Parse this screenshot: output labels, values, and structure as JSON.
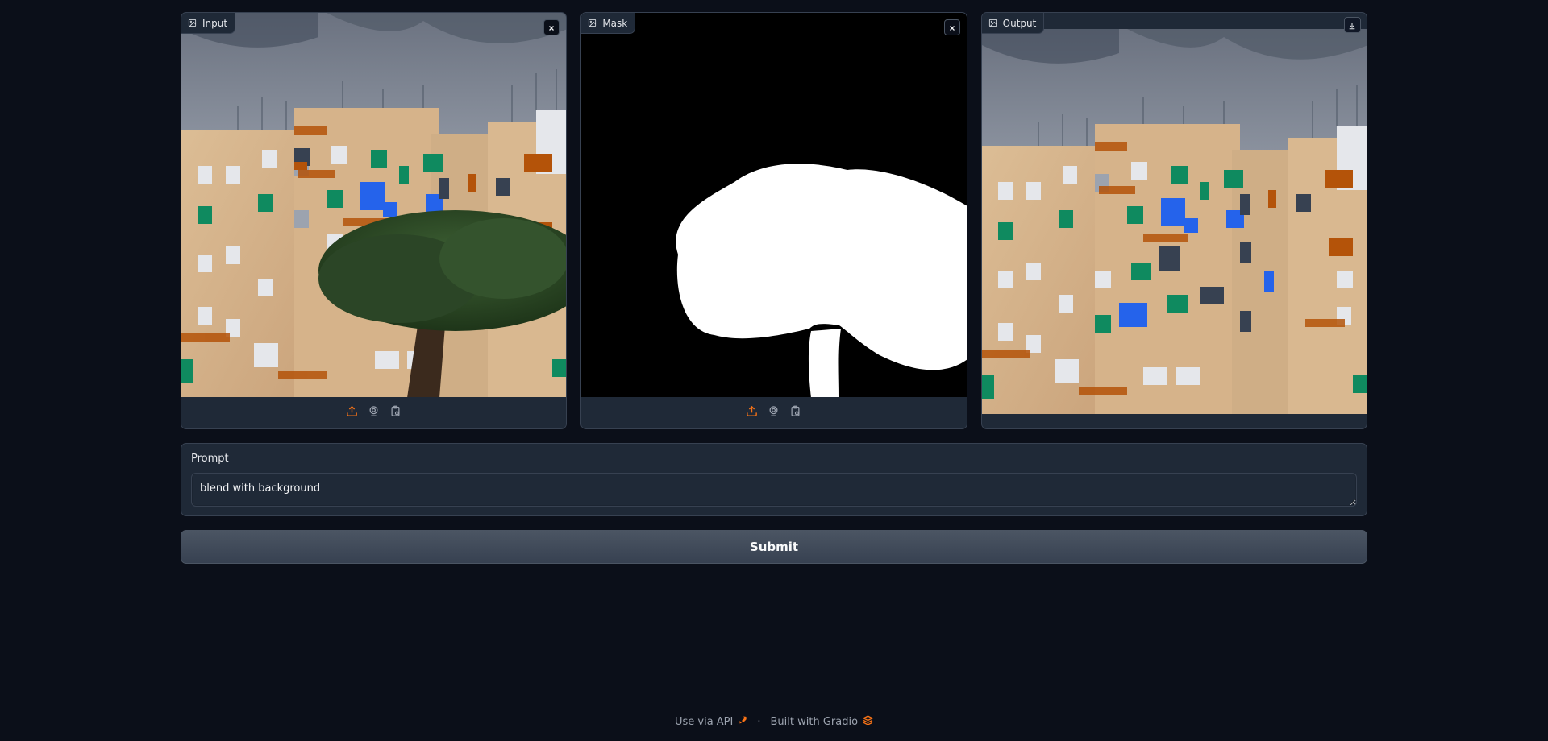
{
  "panels": {
    "input": {
      "label": "Input",
      "image": "building-with-tree-photo"
    },
    "mask": {
      "label": "Mask",
      "image": "tree-mask"
    },
    "output": {
      "label": "Output",
      "image": "building-inpainted-photo"
    }
  },
  "prompt": {
    "label": "Prompt",
    "value": "blend with background"
  },
  "submit_label": "Submit",
  "footer": {
    "api_link": "Use via API",
    "separator": "·",
    "built_with": "Built with Gradio"
  },
  "icons": {
    "panel_label": "image-icon",
    "clear": "close-icon",
    "download": "download-icon",
    "upload": "upload-icon",
    "webcam": "webcam-icon",
    "clipboard": "clipboard-icon",
    "api": "rocket-icon",
    "gradio": "gradio-logo-icon"
  },
  "colors": {
    "background": "#0b0f19",
    "panel": "#1f2937",
    "border": "#374151",
    "accent_orange": "#f97316",
    "sky": "#6b7280",
    "wall": "#d8b48c",
    "window_green": "#0f8a5f",
    "window_blue": "#2563eb",
    "tree": "#2f4a2a"
  }
}
